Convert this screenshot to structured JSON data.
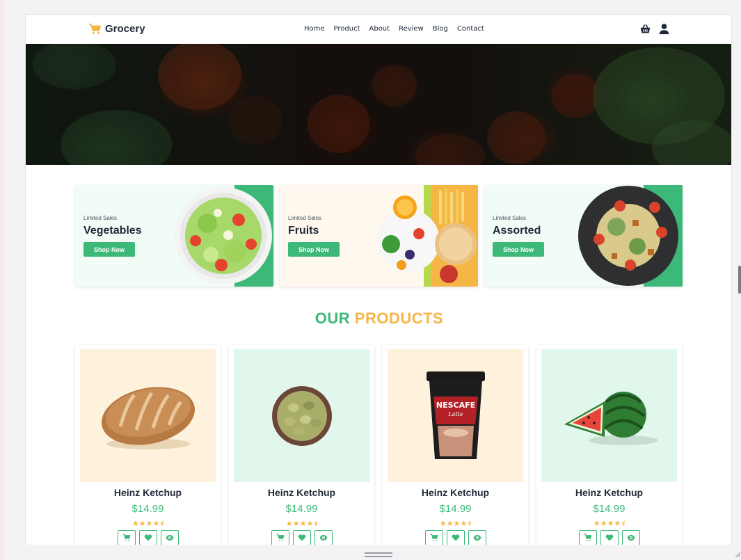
{
  "brand": {
    "name": "Grocery",
    "icon": "cart-icon",
    "accent": "#f6b645"
  },
  "nav": {
    "items": [
      {
        "label": "Home"
      },
      {
        "label": "Product"
      },
      {
        "label": "About"
      },
      {
        "label": "Review"
      },
      {
        "label": "Blog"
      },
      {
        "label": "Contact"
      }
    ]
  },
  "header_icons": [
    "basket-icon",
    "user-icon"
  ],
  "promos": [
    {
      "small": "Limited Sales",
      "title": "Vegetables",
      "button": "Shop Now",
      "accent": "#3cb878"
    },
    {
      "small": "Limited Sales",
      "title": "Fruits",
      "button": "Shop Now",
      "accent": "#f6b645"
    },
    {
      "small": "Limited Sales",
      "title": "Assorted",
      "button": "Shop Now",
      "accent": "#3cb878"
    }
  ],
  "section": {
    "title_part1": "OUR",
    "title_part2": "PRODUCTS",
    "color1": "#3cb878",
    "color2": "#f6b645"
  },
  "products": [
    {
      "name": "Heinz Ketchup",
      "price": "$14.99",
      "rating": 4.5,
      "stars": "★★★★⯨",
      "image": "bread"
    },
    {
      "name": "Heinz Ketchup",
      "price": "$14.99",
      "rating": 4.5,
      "stars": "★★★★⯨",
      "image": "cardamom"
    },
    {
      "name": "Heinz Ketchup",
      "price": "$14.99",
      "rating": 4.5,
      "stars": "★★★★⯨",
      "image": "coffee-cup"
    },
    {
      "name": "Heinz Ketchup",
      "price": "$14.99",
      "rating": 4.5,
      "stars": "★★★★⯨",
      "image": "watermelon"
    }
  ],
  "product_actions": [
    "cart-icon",
    "heart-icon",
    "eye-icon"
  ],
  "colors": {
    "primary": "#3cb878",
    "secondary": "#f6b645",
    "text": "#1f2937"
  }
}
